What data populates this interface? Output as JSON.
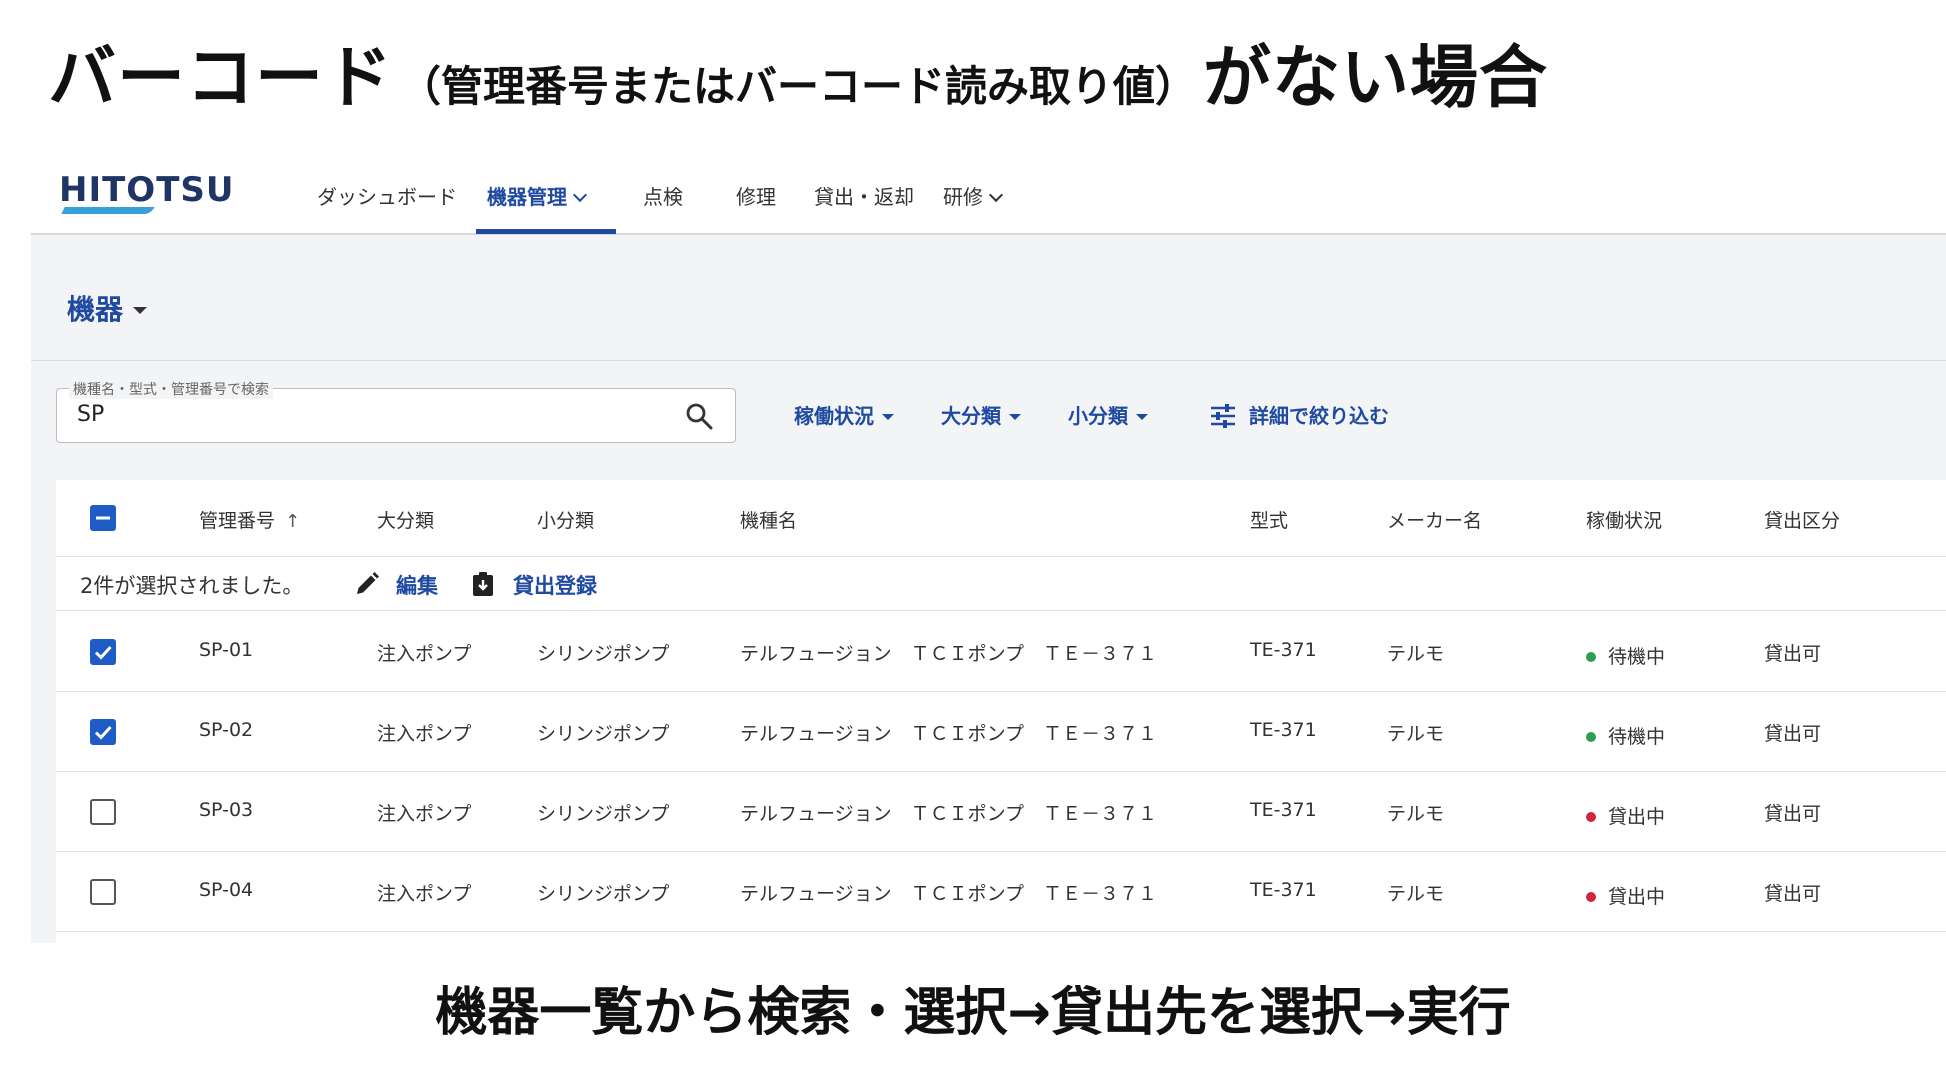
{
  "heading": {
    "part1": "バーコード",
    "part2": "（管理番号またはバーコード読み取り値）",
    "part3": "がない場合"
  },
  "app": {
    "logo": "HITOTSU",
    "nav": [
      {
        "label": "ダッシュボード"
      },
      {
        "label": "機器管理"
      },
      {
        "label": "点検"
      },
      {
        "label": "修理"
      },
      {
        "label": "貸出・返却"
      },
      {
        "label": "研修"
      }
    ],
    "page_title": "機器",
    "search": {
      "label": "機種名・型式・管理番号で検索",
      "value": "SP"
    },
    "filters": [
      "稼働状況",
      "大分類",
      "小分類"
    ],
    "detail_filter": "詳細で絞り込む",
    "columns": [
      "管理番号",
      "大分類",
      "小分類",
      "機種名",
      "型式",
      "メーカー名",
      "稼働状況",
      "貸出区分"
    ],
    "selection": {
      "text": "2件が選択されました。",
      "edit": "編集",
      "lend": "貸出登録"
    },
    "rows": [
      {
        "checked": true,
        "id": "SP-01",
        "major": "注入ポンプ",
        "minor": "シリンジポンプ",
        "model_name": "テルフュージョン　ＴＣＩポンプ　ＴＥ－３７１",
        "model": "TE-371",
        "maker": "テルモ",
        "status": "待機中",
        "status_color": "#2e9e4f",
        "lend": "貸出可"
      },
      {
        "checked": true,
        "id": "SP-02",
        "major": "注入ポンプ",
        "minor": "シリンジポンプ",
        "model_name": "テルフュージョン　ＴＣＩポンプ　ＴＥ－３７１",
        "model": "TE-371",
        "maker": "テルモ",
        "status": "待機中",
        "status_color": "#2e9e4f",
        "lend": "貸出可"
      },
      {
        "checked": false,
        "id": "SP-03",
        "major": "注入ポンプ",
        "minor": "シリンジポンプ",
        "model_name": "テルフュージョン　ＴＣＩポンプ　ＴＥ－３７１",
        "model": "TE-371",
        "maker": "テルモ",
        "status": "貸出中",
        "status_color": "#d0263a",
        "lend": "貸出可"
      },
      {
        "checked": false,
        "id": "SP-04",
        "major": "注入ポンプ",
        "minor": "シリンジポンプ",
        "model_name": "テルフュージョン　ＴＣＩポンプ　ＴＥ－３７１",
        "model": "TE-371",
        "maker": "テルモ",
        "status": "貸出中",
        "status_color": "#d0263a",
        "lend": "貸出可"
      }
    ]
  },
  "caption": "機器一覧から検索・選択→貸出先を選択→実行",
  "colors": {
    "accent": "#1f4aa0",
    "checkbox": "#1f5bc4",
    "logo_bar": "#3aa0dc"
  }
}
